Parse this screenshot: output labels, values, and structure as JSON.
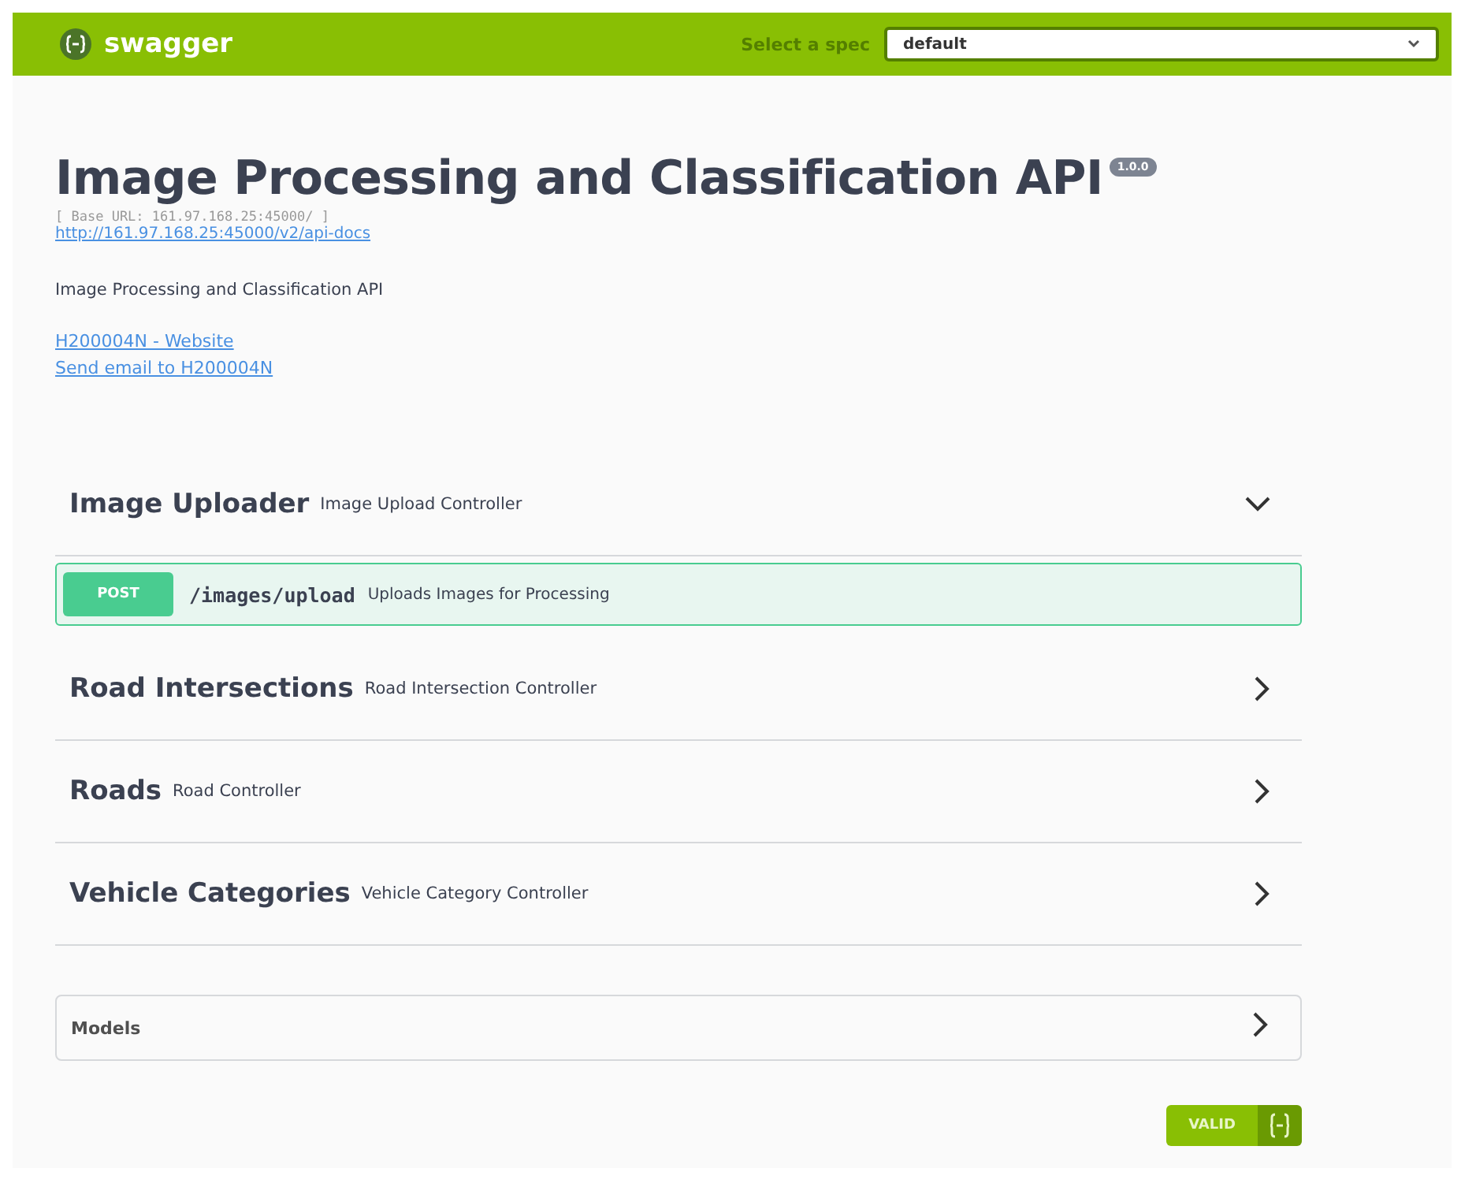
{
  "topbar": {
    "brand": "swagger",
    "spec_label": "Select a spec",
    "spec_value": "default"
  },
  "info": {
    "title": "Image Processing and Classification API",
    "version": "1.0.0",
    "base_url": "[ Base URL: 161.97.168.25:45000/ ]",
    "docs_link": "http://161.97.168.25:45000/v2/api-docs",
    "description": "Image Processing and Classification API",
    "website_link": "H200004N - Website",
    "email_link": "Send email to H200004N"
  },
  "tags": [
    {
      "name": "Image Uploader",
      "description": "Image Upload Controller",
      "expanded": true,
      "operations": [
        {
          "method": "POST",
          "path": "/images/upload",
          "summary": "Uploads Images for Processing"
        }
      ]
    },
    {
      "name": "Road Intersections",
      "description": "Road Intersection Controller",
      "expanded": false
    },
    {
      "name": "Roads",
      "description": "Road Controller",
      "expanded": false
    },
    {
      "name": "Vehicle Categories",
      "description": "Vehicle Category Controller",
      "expanded": false
    }
  ],
  "models": {
    "title": "Models",
    "expanded": false
  },
  "validator": {
    "label": "VALID"
  }
}
